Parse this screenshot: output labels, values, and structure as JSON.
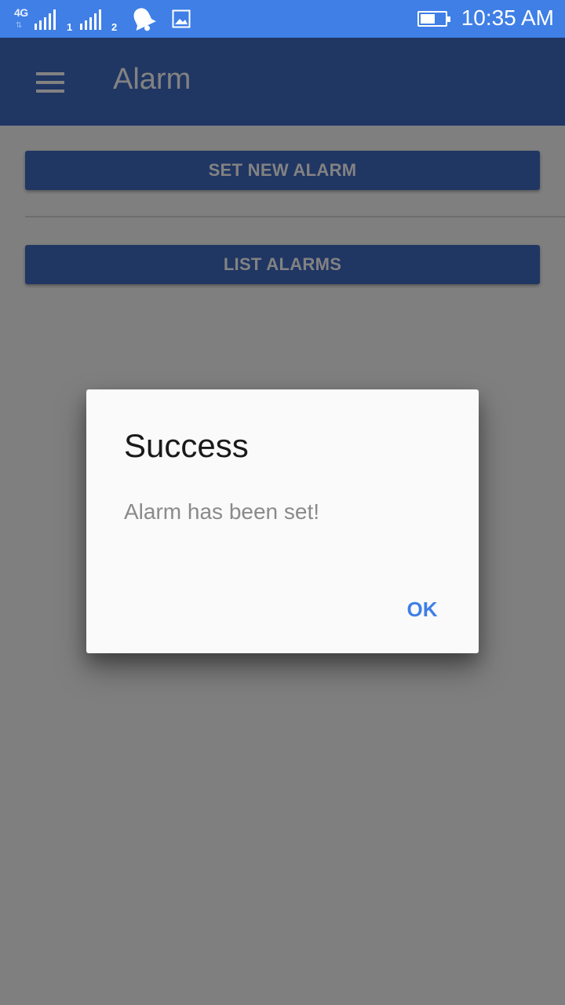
{
  "status_bar": {
    "network_type": "4G",
    "sim1_label": "1",
    "sim2_label": "2",
    "time": "10:35 AM",
    "battery_level": 0.6,
    "icons": [
      "signal-icon",
      "notification-bell-icon",
      "image-icon",
      "battery-icon"
    ]
  },
  "app_bar": {
    "title": "Alarm",
    "menu_icon": "menu-icon"
  },
  "main": {
    "set_alarm_label": "SET NEW ALARM",
    "list_alarms_label": "LIST ALARMS"
  },
  "dialog": {
    "title": "Success",
    "message": "Alarm has been set!",
    "ok_label": "OK"
  },
  "colors": {
    "status_bar": "#3f7fe6",
    "app_bar": "#3f6bc3",
    "accent": "#3f7fe6",
    "dialog_bg": "#fafafa"
  }
}
